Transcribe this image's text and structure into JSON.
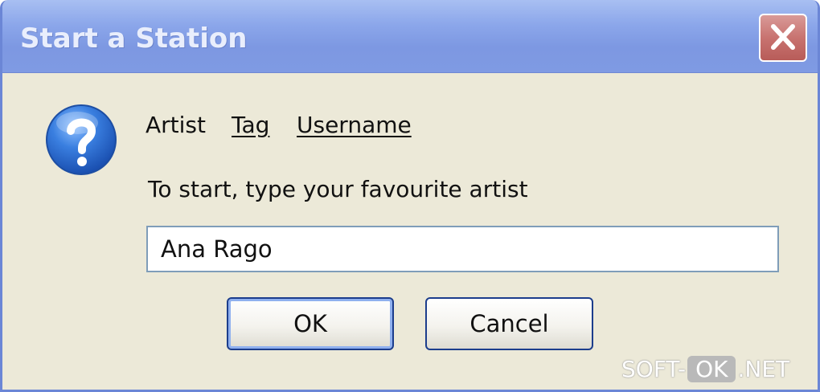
{
  "window": {
    "title": "Start a Station",
    "close_icon": "close-icon"
  },
  "dialog": {
    "icon": "question-icon",
    "modes": [
      {
        "label": "Artist",
        "selected": true
      },
      {
        "label": "Tag",
        "selected": false
      },
      {
        "label": "Username",
        "selected": false
      }
    ],
    "prompt": "To start, type your favourite artist",
    "artist_input": {
      "value": "Ana Rago"
    },
    "buttons": {
      "ok_label": "OK",
      "cancel_label": "Cancel"
    }
  },
  "watermark": {
    "left": "SOFT-",
    "mid": "OK",
    "right": ".NET"
  },
  "colors": {
    "titlebar": "#8ba6ea",
    "window_bg": "#ece9d8",
    "close_button": "#c87370",
    "question_icon": "#2f6fd6",
    "button_border": "#1c3d8c"
  }
}
